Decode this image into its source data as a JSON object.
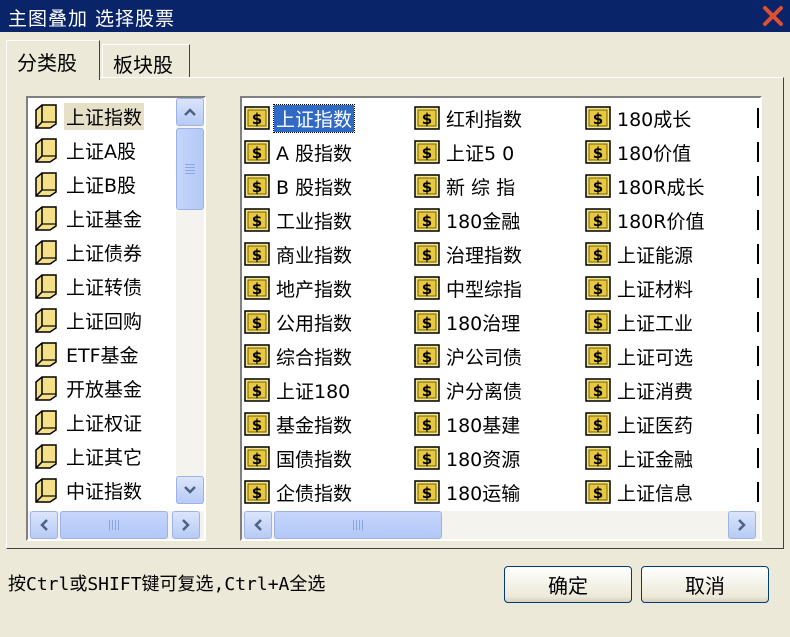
{
  "window": {
    "title": "主图叠加 选择股票"
  },
  "tabs": [
    {
      "label": "分类股",
      "active": true
    },
    {
      "label": "板块股",
      "active": false
    }
  ],
  "categories": [
    {
      "label": "上证指数",
      "selected": true
    },
    {
      "label": "上证A股"
    },
    {
      "label": "上证B股"
    },
    {
      "label": "上证基金"
    },
    {
      "label": "上证债券"
    },
    {
      "label": "上证转债"
    },
    {
      "label": "上证回购"
    },
    {
      "label": "ETF基金"
    },
    {
      "label": "开放基金"
    },
    {
      "label": "上证权证"
    },
    {
      "label": "上证其它"
    },
    {
      "label": "中证指数"
    }
  ],
  "stocks": {
    "col1": [
      "上证指数",
      "A 股指数",
      "B 股指数",
      "工业指数",
      "商业指数",
      "地产指数",
      "公用指数",
      "综合指数",
      "上证180",
      "基金指数",
      "国债指数",
      "企债指数"
    ],
    "col2": [
      "红利指数",
      "上证5 0",
      "新 综 指",
      "180金融",
      "治理指数",
      "中型综指",
      "180治理",
      "沪公司债",
      "沪分离债",
      "180基建",
      "180资源",
      "180运输"
    ],
    "col3": [
      "180成长",
      "180价值",
      "180R成长",
      "180R价值",
      "上证能源",
      "上证材料",
      "上证工业",
      "上证可选",
      "上证消费",
      "上证医药",
      "上证金融",
      "上证信息"
    ]
  },
  "selected_stock": "上证指数",
  "status_text": "按Ctrl或SHIFT键可复选,Ctrl+A全选",
  "buttons": {
    "ok": "确定",
    "cancel": "取消"
  },
  "icons": {
    "category": "folder-icon",
    "stock": "dollar-icon"
  },
  "colors": {
    "title_bar": "#0a246a",
    "selection": "#316ac5",
    "close": "#e05030"
  }
}
